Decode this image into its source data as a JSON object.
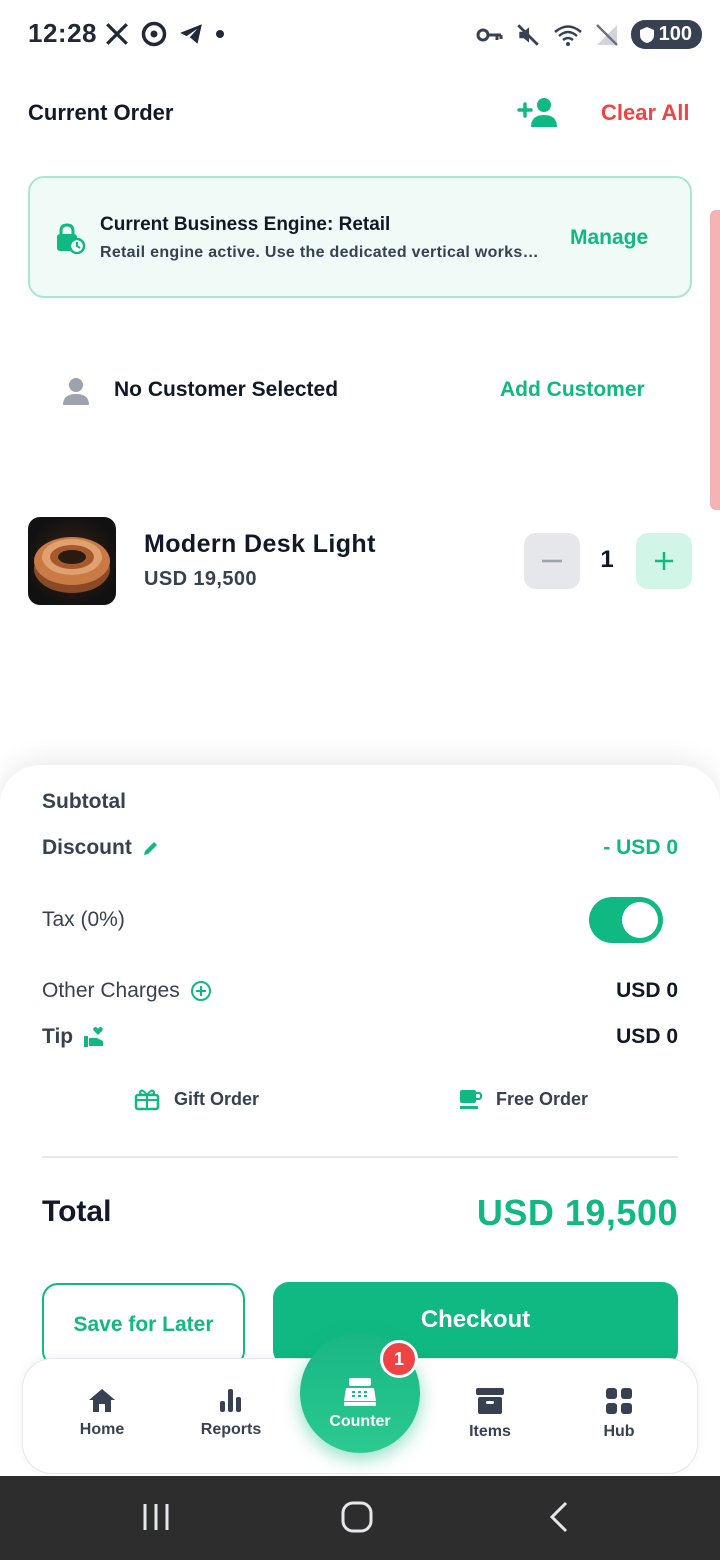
{
  "status_bar": {
    "time": "12:28",
    "battery": "100",
    "left_icons": [
      "x-icon",
      "app-icon",
      "telegram-icon",
      "dot-icon"
    ],
    "right_icons": [
      "key-icon",
      "mute-icon",
      "wifi-icon",
      "no-signal-icon"
    ]
  },
  "header": {
    "title": "Current Order",
    "clear_all": "Clear All"
  },
  "engine": {
    "title": "Current Business Engine: Retail",
    "subtitle": "Retail engine active. Use the dedicated vertical workspace for advanced features.",
    "manage": "Manage"
  },
  "customer": {
    "label": "No Customer Selected",
    "add": "Add Customer"
  },
  "items": [
    {
      "name": "Modern Desk Light",
      "price": "USD 19,500",
      "qty": "1"
    }
  ],
  "summary": {
    "subtotal_label": "Subtotal",
    "discount_label": "Discount",
    "discount_value": "- USD 0",
    "tax_label": "Tax (0%)",
    "tax_enabled": true,
    "other_label": "Other Charges",
    "other_value": "USD 0",
    "tip_label": "Tip",
    "tip_value": "USD 0",
    "gift_label": "Gift Order",
    "free_label": "Free Order",
    "total_label": "Total",
    "total_value": "USD 19,500"
  },
  "actions": {
    "save_later": "Save for Later",
    "checkout": "Checkout"
  },
  "nav": {
    "home": "Home",
    "reports": "Reports",
    "counter": "Counter",
    "counter_badge": "1",
    "items": "Items",
    "hub": "Hub"
  },
  "colors": {
    "accent": "#10b981",
    "danger": "#ef4444"
  }
}
